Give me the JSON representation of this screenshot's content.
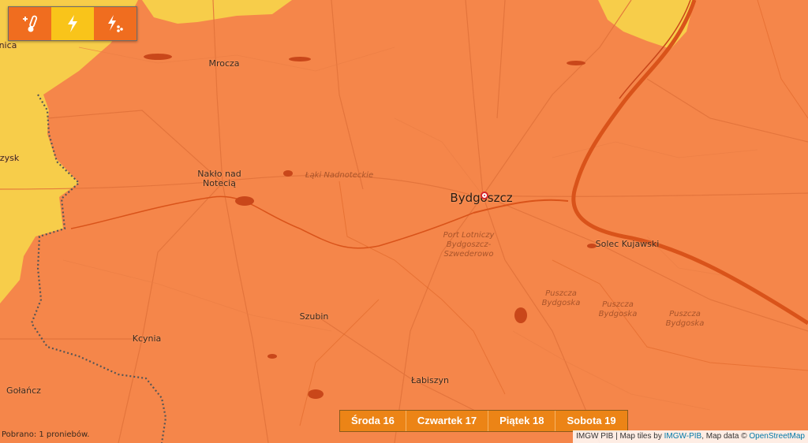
{
  "colors": {
    "warning_orange": "#f5864a",
    "warning_yellow": "#f7cd4a",
    "river": "#d9531a",
    "border_dots": "#555555",
    "day_button": "#ec8416",
    "marker": "#d5252b"
  },
  "phenomena": [
    {
      "icon": "heat-thermometer-icon",
      "color": "#f06d1f"
    },
    {
      "icon": "lightning-icon",
      "color": "#f9c41a"
    },
    {
      "icon": "thunderstorm-hail-icon",
      "color": "#f06d1f"
    }
  ],
  "places": {
    "mrocza": "Mrocza",
    "naklo": "Nakło nad\nNotecią",
    "bydgoszcz": "Bydgoszcz",
    "solec": "Solec Kujawski",
    "szubin": "Szubin",
    "kcynia": "Kcynia",
    "labiszyn": "Łabiszyn",
    "golancz": "Gołańcz",
    "nica": "nica",
    "zysk": "zysk"
  },
  "natural_labels": {
    "laki": "Łąki Nadnoteckie",
    "port": "Port Lotniczy\nBydgoszcz-\nSzwederowo",
    "puszcza1": "Puszcza\nBydgoska",
    "puszcza2": "Puszcza\nBydgoska",
    "puszcza3": "Puszcza\nBydgoska"
  },
  "days": [
    "Środa 16",
    "Czwartek 17",
    "Piątek 18",
    "Sobota 19"
  ],
  "status_text": "Pobrano: 1 proniebów.",
  "attribution": {
    "prefix": "IMGW PIB | Map tiles by ",
    "tiles_link": "IMGW-PIB",
    "middle": ", Map data © ",
    "data_link": "OpenStreetMap"
  }
}
